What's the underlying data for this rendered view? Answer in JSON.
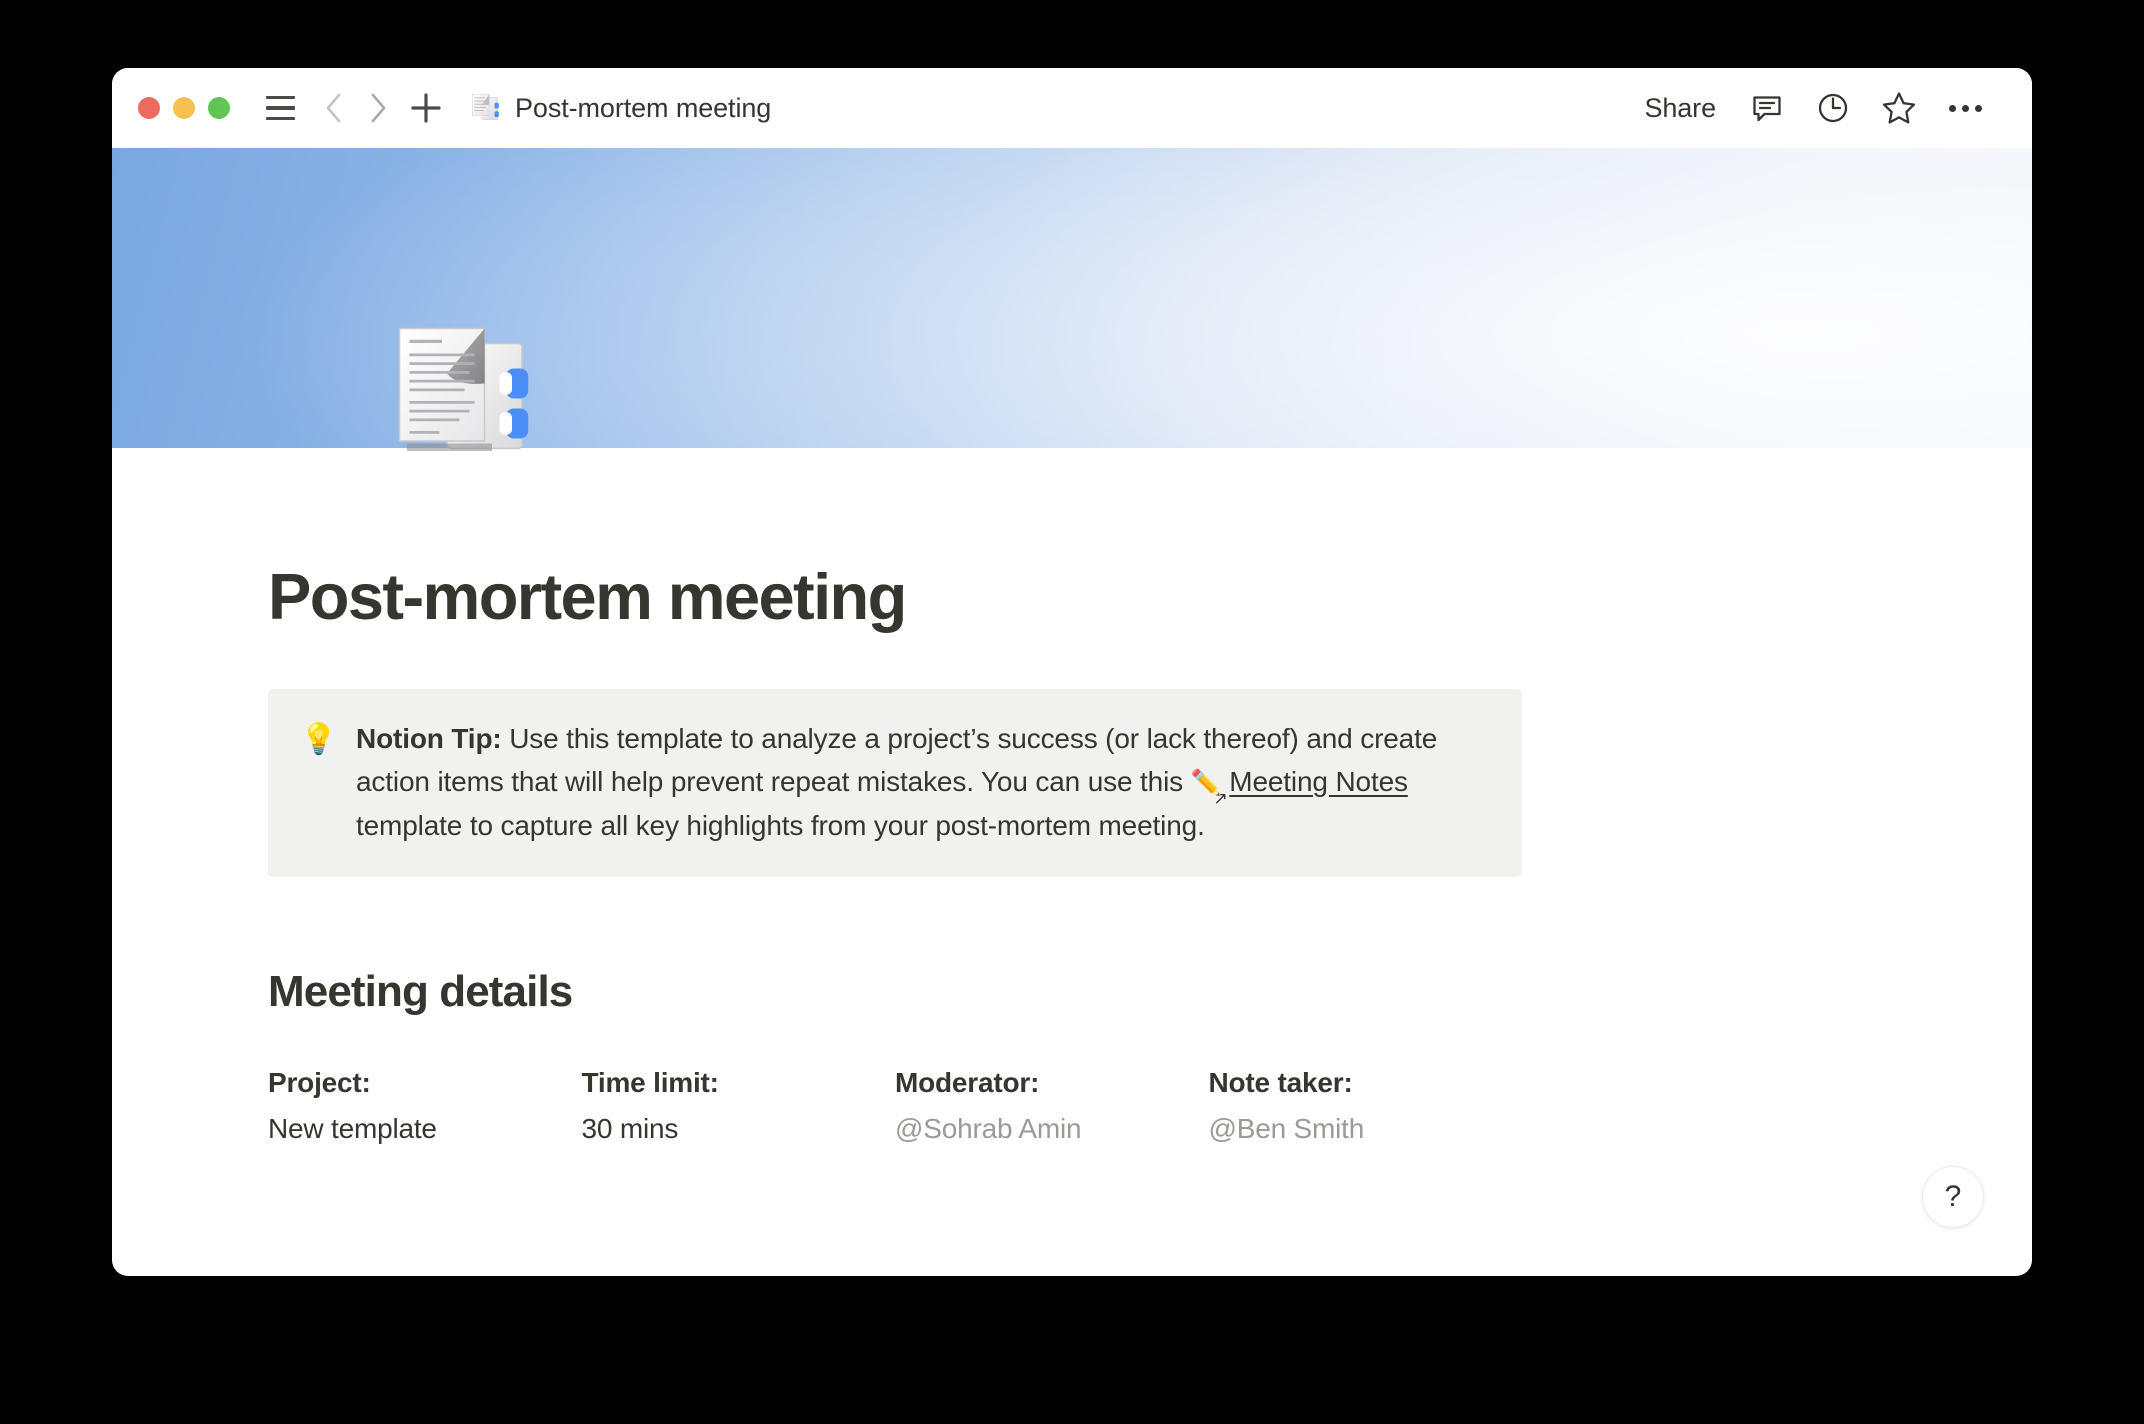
{
  "window": {
    "traffic_lights": [
      {
        "name": "close",
        "color": "#ED6A5E"
      },
      {
        "name": "minimize",
        "color": "#F5C04F"
      },
      {
        "name": "maximize",
        "color": "#61C554"
      }
    ],
    "breadcrumb_title": "Post-mortem meeting",
    "breadcrumb_icon": "pages-document-icon",
    "toolbar": {
      "sidebar_toggle_icon": "hamburger-menu-icon",
      "back_icon": "chevron-left-icon",
      "forward_icon": "chevron-right-icon",
      "new_page_icon": "plus-icon",
      "share_label": "Share",
      "comments_icon": "comment-bubble-icon",
      "history_icon": "clock-history-icon",
      "favorite_icon": "star-icon",
      "more_icon": "ellipsis-icon"
    }
  },
  "cover": {
    "gradient_from": "#7aa7e0",
    "gradient_to": "#e8edf6"
  },
  "page": {
    "icon": "pages-document-icon",
    "title": "Post-mortem meeting"
  },
  "callout": {
    "emoji": "💡",
    "emoji_name": "light-bulb-emoji",
    "lead_bold": "Notion Tip:",
    "text_part_1": " Use this template to analyze a project’s success (or lack thereof) and create action items that will help prevent repeat mistakes. You can use this ",
    "link_emoji": "✏️",
    "link_emoji_name": "pencil-emoji",
    "link_label": "Meeting Notes",
    "text_part_2": " template to capture all key highlights from your post-mortem meeting.",
    "background_color": "#f1f1ef"
  },
  "meeting_details": {
    "heading": "Meeting details",
    "columns": [
      {
        "label": "Project:",
        "value": "New template",
        "is_mention": false
      },
      {
        "label": "Time limit:",
        "value": "30 mins",
        "is_mention": false
      },
      {
        "label": "Moderator:",
        "value": "@Sohrab Amin",
        "is_mention": true
      },
      {
        "label": "Note taker:",
        "value": "@Ben Smith",
        "is_mention": true
      }
    ]
  },
  "help": {
    "label": "?"
  }
}
